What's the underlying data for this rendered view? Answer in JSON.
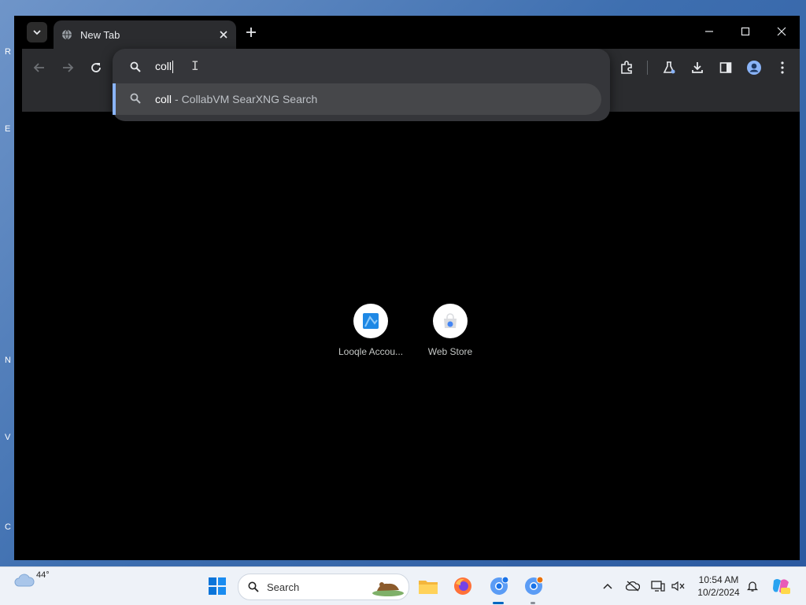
{
  "browser": {
    "tab_title": "New Tab",
    "omnibox_input": "coll",
    "suggestion": {
      "query": "coll",
      "description": "- CollabVM SearXNG Search"
    },
    "shortcuts": [
      {
        "label": "Looqle Accou..."
      },
      {
        "label": "Web Store"
      }
    ]
  },
  "desktop": {
    "edge_letters": [
      "R",
      "E",
      "N",
      "V",
      "C"
    ]
  },
  "taskbar": {
    "weather_temp": "44°",
    "search_label": "Search",
    "time": "10:54 AM",
    "date": "10/2/2024"
  },
  "colors": {
    "accent": "#8ab4f8",
    "toolbar": "#2b2c2f",
    "omnibox": "#35363a",
    "taskbar": "#eef2f8"
  },
  "icons": [
    "tab-search-icon",
    "globe-icon",
    "close-icon",
    "plus-icon",
    "minimize-icon",
    "maximize-icon",
    "window-close-icon",
    "back-icon",
    "forward-icon",
    "reload-icon",
    "search-icon",
    "extensions-icon",
    "labs-icon",
    "download-icon",
    "side-panel-icon",
    "profile-icon",
    "more-icon",
    "windows-start-icon",
    "file-explorer-icon",
    "firefox-icon",
    "chrome-icon"
  ]
}
